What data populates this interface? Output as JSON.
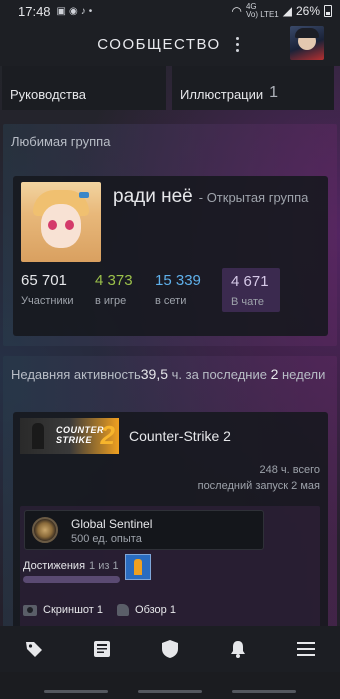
{
  "status_bar": {
    "time": "17:48",
    "network": "Vo) LTE1",
    "signal": "4G",
    "battery": "26%"
  },
  "header": {
    "title": "СООБЩЕСТВО"
  },
  "tiles": [
    {
      "label": "Руководства",
      "count": ""
    },
    {
      "label": "Иллюстрации",
      "count": "1"
    }
  ],
  "favorite_group": {
    "section_title": "Любимая группа",
    "name": "ради неё",
    "type": "- Открытая группа",
    "stats": {
      "members": {
        "value": "65 701",
        "label": "Участники"
      },
      "in_game": {
        "value": "4 373",
        "label": "в игре"
      },
      "online": {
        "value": "15 339",
        "label": "в сети"
      },
      "in_chat": {
        "value": "4 671",
        "label": "В чате"
      }
    }
  },
  "recent_activity": {
    "title": "Недавняя активность",
    "hours": "39,5",
    "unit": " ч.",
    "period_prefix": " за последние ",
    "period_num": "2",
    "period_suffix": " недели",
    "game": {
      "banner_text_line1": "COUNTER",
      "banner_text_line2": "STRIKE",
      "banner_number": "2",
      "title": "Counter-Strike 2",
      "total_hours": "248 ч. всего",
      "last_played": "последний запуск 2 мая",
      "badge": {
        "name": "Global Sentinel",
        "xp": "500 ед. опыта"
      },
      "achievements": {
        "label": "Достижения",
        "count": "1 из 1",
        "progress": 1.0
      },
      "screenshots": "Скриншот 1",
      "reviews": "Обзор 1"
    }
  },
  "colors": {
    "in_game": "#9bc04a",
    "online": "#5fb0ea",
    "chat_bg": "#3b2a4f"
  }
}
